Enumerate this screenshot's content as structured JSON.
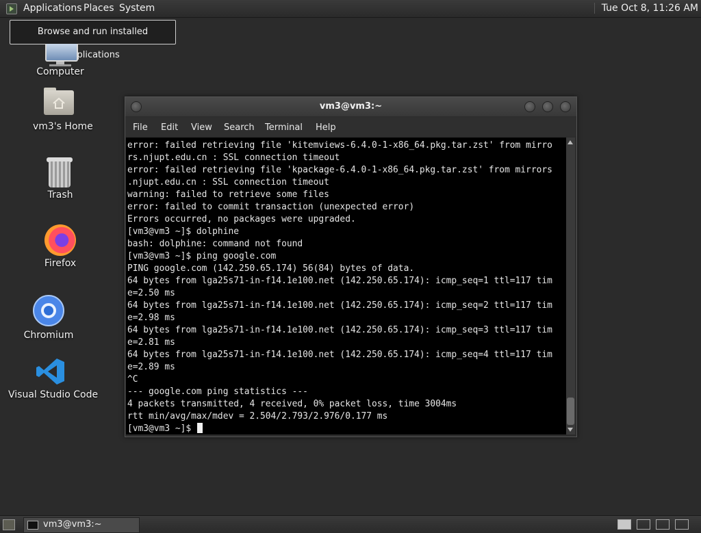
{
  "top_panel": {
    "menus": [
      "Applications",
      "Places",
      "System"
    ],
    "clock": "Tue Oct  8, 11:26 AM",
    "tooltip": "Browse and run installed applications"
  },
  "desktop_icons": [
    {
      "name": "computer",
      "label": "Computer"
    },
    {
      "name": "home",
      "label": "vm3's Home"
    },
    {
      "name": "trash",
      "label": "Trash"
    },
    {
      "name": "firefox",
      "label": "Firefox"
    },
    {
      "name": "chromium",
      "label": "Chromium"
    },
    {
      "name": "vscode",
      "label": "Visual Studio Code"
    }
  ],
  "terminal": {
    "title": "vm3@vm3:~",
    "menu": [
      "File",
      "Edit",
      "View",
      "Search",
      "Terminal",
      "Help"
    ],
    "lines": [
      "error: failed retrieving file 'kitemviews-6.4.0-1-x86_64.pkg.tar.zst' from mirro",
      "rs.njupt.edu.cn : SSL connection timeout",
      "error: failed retrieving file 'kpackage-6.4.0-1-x86_64.pkg.tar.zst' from mirrors",
      ".njupt.edu.cn : SSL connection timeout",
      "warning: failed to retrieve some files",
      "error: failed to commit transaction (unexpected error)",
      "Errors occurred, no packages were upgraded.",
      "[vm3@vm3 ~]$ dolphine",
      "bash: dolphine: command not found",
      "[vm3@vm3 ~]$ ping google.com",
      "PING google.com (142.250.65.174) 56(84) bytes of data.",
      "64 bytes from lga25s71-in-f14.1e100.net (142.250.65.174): icmp_seq=1 ttl=117 tim",
      "e=2.50 ms",
      "64 bytes from lga25s71-in-f14.1e100.net (142.250.65.174): icmp_seq=2 ttl=117 tim",
      "e=2.98 ms",
      "64 bytes from lga25s71-in-f14.1e100.net (142.250.65.174): icmp_seq=3 ttl=117 tim",
      "e=2.81 ms",
      "64 bytes from lga25s71-in-f14.1e100.net (142.250.65.174): icmp_seq=4 ttl=117 tim",
      "e=2.89 ms",
      "^C",
      "--- google.com ping statistics ---",
      "4 packets transmitted, 4 received, 0% packet loss, time 3004ms",
      "rtt min/avg/max/mdev = 2.504/2.793/2.976/0.177 ms"
    ],
    "prompt": "[vm3@vm3 ~]$ "
  },
  "taskbar": {
    "task_label": "vm3@vm3:~"
  }
}
